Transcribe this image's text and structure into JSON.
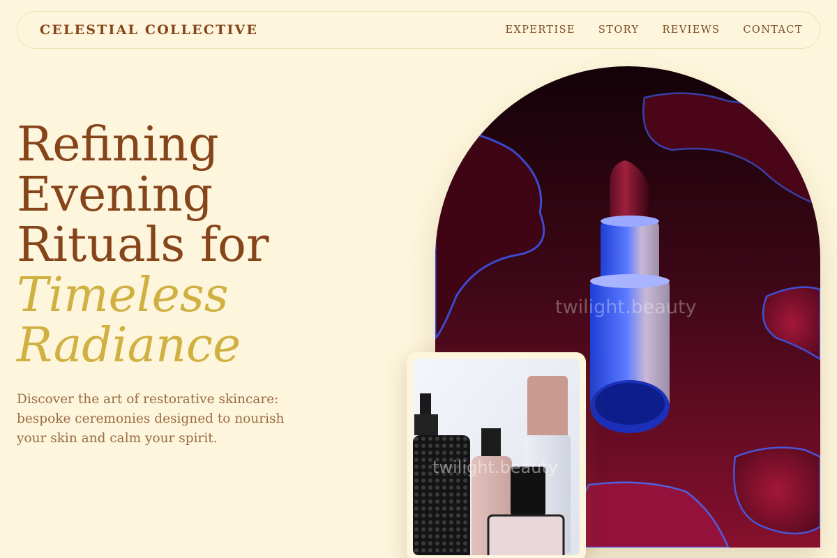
{
  "header": {
    "brand": "CELESTIAL COLLECTIVE",
    "nav": [
      "EXPERTISE",
      "STORY",
      "REVIEWS",
      "CONTACT"
    ]
  },
  "hero": {
    "title_lines": [
      "Refining",
      "Evening",
      "Rituals for"
    ],
    "title_accent_lines": [
      "Timeless",
      "Radiance"
    ],
    "description": "Discover the art of restorative skincare: bespoke ceremonies designed to nourish your skin and calm your spirit."
  },
  "images": {
    "main_watermark": "twilight.beauty",
    "card_watermark": "twilight.beauty"
  },
  "colors": {
    "background": "#fdf6dc",
    "brand": "#86441a",
    "accent": "#d1b042",
    "body_text": "#9a6a44"
  }
}
